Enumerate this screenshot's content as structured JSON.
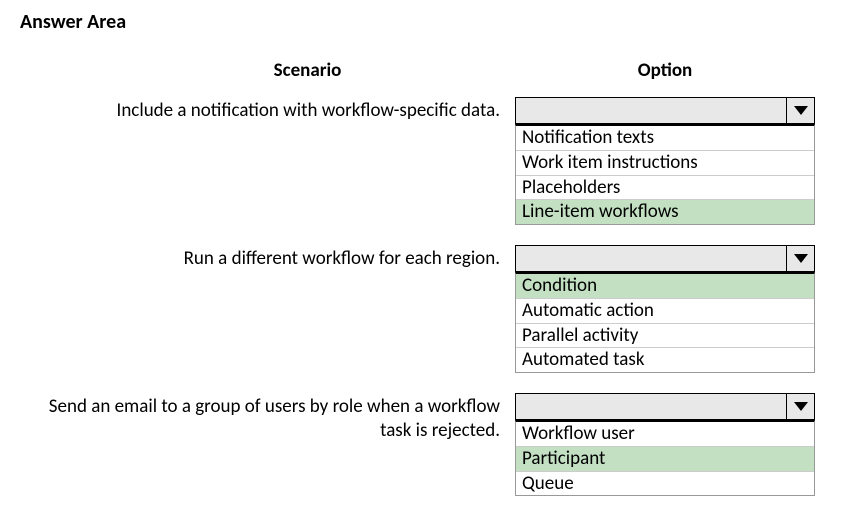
{
  "header": "Answer Area",
  "columns": {
    "scenario": "Scenario",
    "option": "Option"
  },
  "rows": [
    {
      "scenario": "Include a notification with workflow-specific data.",
      "options": [
        {
          "label": "Notification texts",
          "highlighted": false
        },
        {
          "label": "Work item instructions",
          "highlighted": false
        },
        {
          "label": "Placeholders",
          "highlighted": false
        },
        {
          "label": "Line-item workflows",
          "highlighted": true
        }
      ]
    },
    {
      "scenario": "Run a different workflow for each region.",
      "options": [
        {
          "label": "Condition",
          "highlighted": true
        },
        {
          "label": "Automatic action",
          "highlighted": false
        },
        {
          "label": "Parallel activity",
          "highlighted": false
        },
        {
          "label": "Automated task",
          "highlighted": false
        }
      ]
    },
    {
      "scenario": "Send an email to a group of users by role when a workflow task is rejected.",
      "options": [
        {
          "label": "Workflow user",
          "highlighted": false
        },
        {
          "label": "Participant",
          "highlighted": true
        },
        {
          "label": "Queue",
          "highlighted": false
        }
      ]
    }
  ]
}
